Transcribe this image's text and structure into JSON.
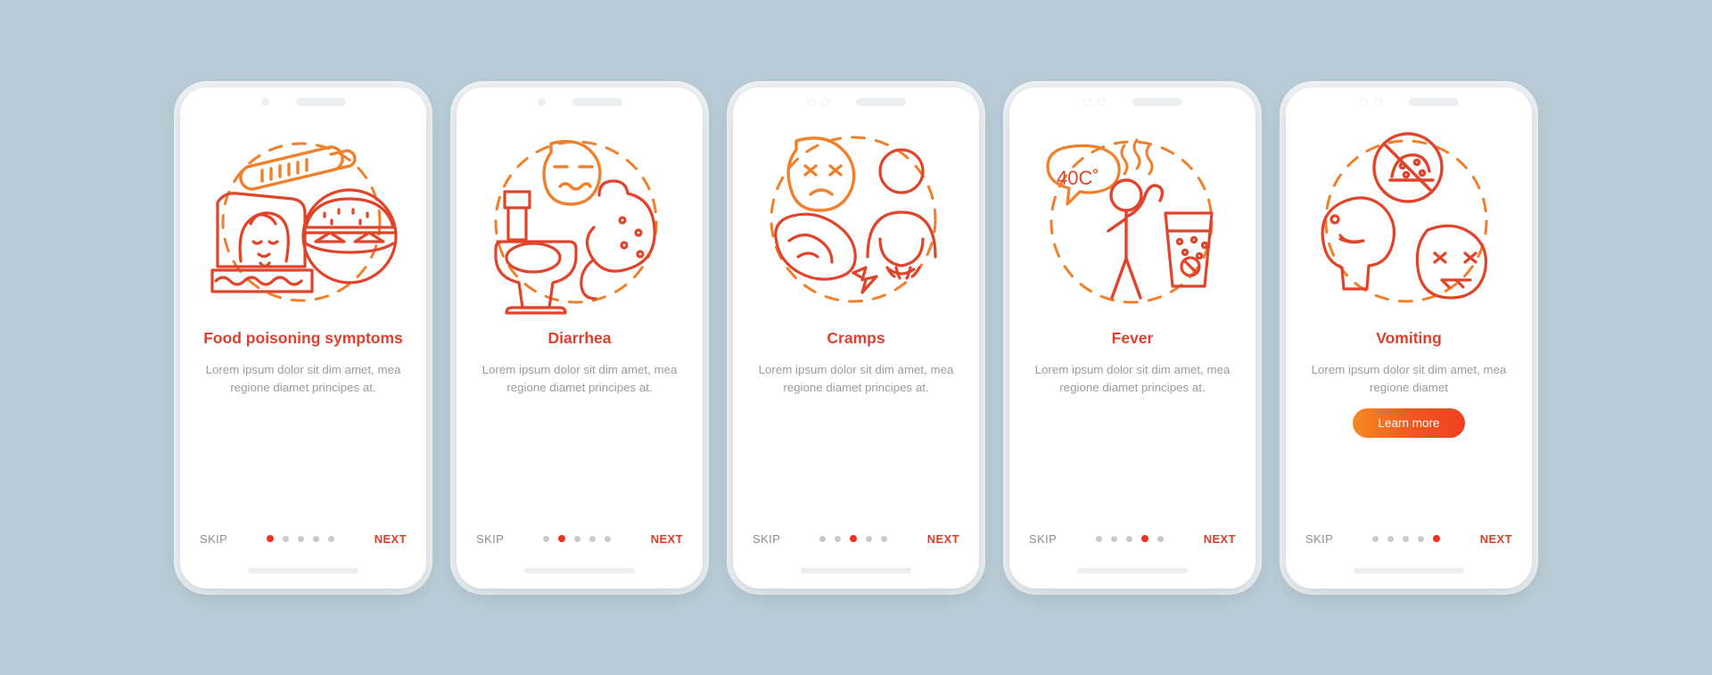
{
  "theme": {
    "background": "#b8cbd6",
    "card_background": "#ffffff",
    "title_color": "#e0402e",
    "body_color": "#9b9b9b",
    "accent_color": "#ef3124",
    "skip_color": "#8d8d8d",
    "next_color": "#e23b25",
    "dot_inactive": "#c9c9c9",
    "button_gradient_from": "#f68a21",
    "button_gradient_to": "#ef3f23",
    "line_art_light": "#f0802c",
    "line_art_dark": "#e0442a"
  },
  "nav": {
    "skip_label": "SKIP",
    "next_label": "NEXT",
    "dot_count": 5
  },
  "screens": [
    {
      "id": "food-poisoning-symptoms",
      "title": "Food poisoning symptoms",
      "body": "Lorem ipsum dolor sit dim amet, mea regione diamet principes at.",
      "active_dot": 1,
      "illustration": "sick-woman-in-bed-thermometer-burger-icon",
      "statusbar": "single-dot-and-bar",
      "cta": null
    },
    {
      "id": "diarrhea",
      "title": "Diarrhea",
      "body": "Lorem ipsum dolor sit dim amet, mea regione diamet principes at.",
      "active_dot": 2,
      "illustration": "toilet-nauseous-face-stomach-icon",
      "statusbar": "single-dot-and-bar",
      "cta": null
    },
    {
      "id": "cramps",
      "title": "Cramps",
      "body": "Lorem ipsum dolor sit dim amet, mea regione diamet principes at.",
      "active_dot": 3,
      "illustration": "sad-face-person-holding-belly-intestine-icon",
      "statusbar": "double-ring-and-bar",
      "cta": null
    },
    {
      "id": "fever",
      "title": "Fever",
      "body": "Lorem ipsum dolor sit dim amet, mea regione diamet principes at.",
      "active_dot": 4,
      "illustration": "person-with-40c-speech-bubble-and-hot-drink-icon",
      "statusbar": "double-ring-and-bar",
      "cta": null,
      "bubble_label": "40C˚"
    },
    {
      "id": "vomiting",
      "title": "Vomiting",
      "body": "Lorem ipsum dolor sit dim amet, mea regione diamet",
      "active_dot": 5,
      "illustration": "no-food-sign-vomiting-head-sick-face-icon",
      "statusbar": "double-ring-and-bar",
      "cta": "Learn more"
    }
  ]
}
